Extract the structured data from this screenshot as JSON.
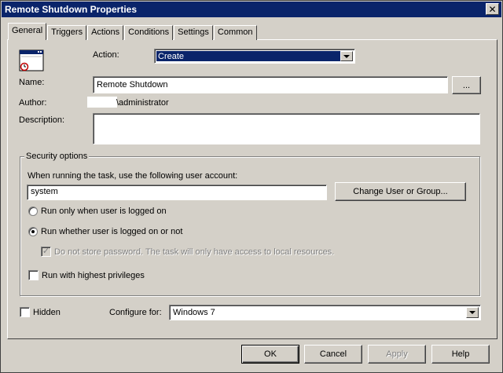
{
  "window": {
    "title": "Remote Shutdown Properties"
  },
  "tabs": [
    {
      "label": "General",
      "active": true
    },
    {
      "label": "Triggers"
    },
    {
      "label": "Actions"
    },
    {
      "label": "Conditions"
    },
    {
      "label": "Settings"
    },
    {
      "label": "Common"
    }
  ],
  "general": {
    "action_label": "Action:",
    "action_value": "Create",
    "name_label": "Name:",
    "name_value": "Remote Shutdown",
    "browse_label": "...",
    "author_label": "Author:",
    "author_value": "\\administrator",
    "description_label": "Description:",
    "description_value": ""
  },
  "security": {
    "title": "Security options",
    "account_prompt": "When running the task, use the following user account:",
    "account_value": "system",
    "change_user_button": "Change User or Group...",
    "run_logged_on_label": "Run only when user is logged on",
    "run_whether_label": "Run whether user is logged on or not",
    "no_store_password_label": "Do not store password. The task will only have access to local resources.",
    "highest_privileges_label": "Run with highest privileges",
    "run_mode": "whether",
    "no_store_password_checked": true,
    "highest_privileges_checked": false
  },
  "bottom": {
    "hidden_label": "Hidden",
    "hidden_checked": false,
    "configure_label": "Configure for:",
    "configure_value": "Windows 7"
  },
  "buttons": {
    "ok": "OK",
    "cancel": "Cancel",
    "apply": "Apply",
    "help": "Help"
  },
  "icons": {
    "close": "close-icon",
    "task": "scheduled-task-icon",
    "dropdown": "chevron-down-icon"
  },
  "colors": {
    "face": "#d4d0c8",
    "title_bar": "#0a246a",
    "selection": "#0a246a"
  }
}
